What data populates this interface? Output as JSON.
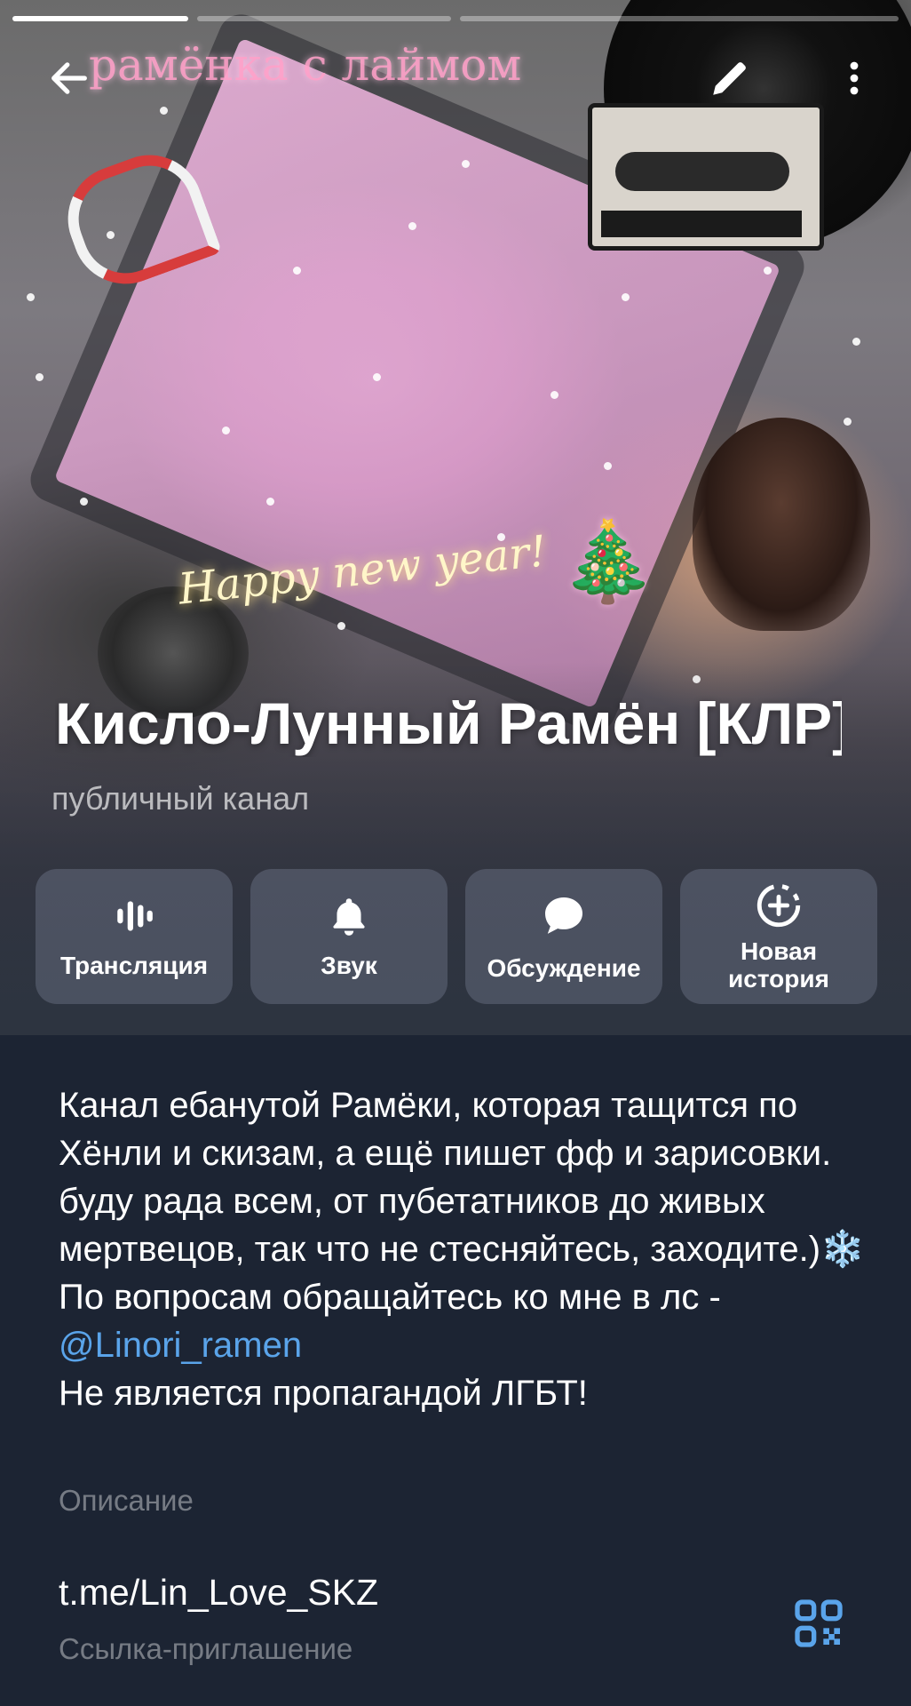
{
  "story": {
    "decor_title": "рамёнка с лаймом",
    "decor_greeting": "Happy new year!",
    "decor_emoji": "🎄"
  },
  "toolbar": {
    "back_icon": "arrow-left-icon",
    "edit_icon": "pencil-icon",
    "more_icon": "more-vertical-icon"
  },
  "channel": {
    "title": "Кисло-Лунный Рамён [КЛР]",
    "type": "публичный канал"
  },
  "actions": [
    {
      "label": "Трансляция",
      "icon": "live-stream-icon"
    },
    {
      "label": "Звук",
      "icon": "bell-icon"
    },
    {
      "label": "Обсуждение",
      "icon": "chat-bubble-icon"
    },
    {
      "label": "Новая\nистория",
      "icon": "add-story-icon"
    }
  ],
  "description": {
    "line1": "Канал ебанутой Рамёки, которая тащится по Хёнли и скизам, а ещё пишет фф и зарисовки. буду рада всем, от пубетатников до живых мертвецов, так что не стесняйтесь, заходите.)❄️",
    "line2_prefix": "По вопросам обращайтесь ко мне в лс - ",
    "line2_link": "@Linori_ramen",
    "line3": "Не является пропагандой ЛГБТ!",
    "caption": "Описание"
  },
  "invite": {
    "link": "t.me/Lin_Love_SKZ",
    "caption": "Ссылка-приглашение",
    "qr_icon": "qr-code-icon"
  },
  "colors": {
    "background": "#1c2433",
    "link": "#5aa4ea",
    "accent": "#5aa4ea"
  }
}
